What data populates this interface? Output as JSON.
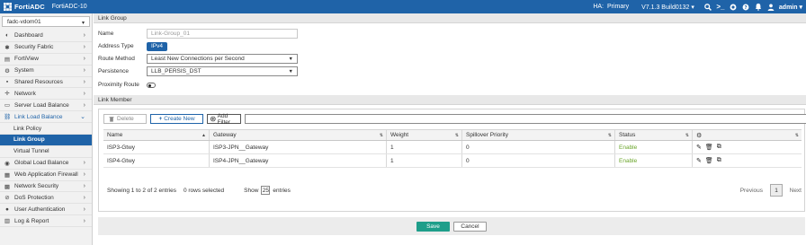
{
  "topbar": {
    "brand": "FortiADC",
    "model": "FortiADC-10",
    "ha_label": "HA:",
    "ha_value": "Primary",
    "version": "V7.1.3 Build0132",
    "version_caret": "▾",
    "user": "admin",
    "user_caret": "▾",
    "colors": {
      "bar": "#1f63a8"
    }
  },
  "sidebar": {
    "vdom": "fadc-vdom01",
    "items": [
      {
        "label": "Dashboard",
        "icon": "dashboard-icon",
        "glyph": "◐"
      },
      {
        "label": "Security Fabric",
        "icon": "security-fabric-icon",
        "glyph": "✱"
      },
      {
        "label": "FortiView",
        "icon": "fortiview-icon",
        "glyph": "▤"
      },
      {
        "label": "System",
        "icon": "gear-icon",
        "glyph": "⚙"
      },
      {
        "label": "Shared Resources",
        "icon": "shared-resources-icon",
        "glyph": "▪"
      },
      {
        "label": "Network",
        "icon": "network-icon",
        "glyph": "✛"
      },
      {
        "label": "Server Load Balance",
        "icon": "server-load-balance-icon",
        "glyph": "▭"
      },
      {
        "label": "Link Load Balance",
        "icon": "link-icon",
        "glyph": "🔗"
      },
      {
        "label": "Link Policy"
      },
      {
        "label": "Link Group"
      },
      {
        "label": "Virtual Tunnel"
      },
      {
        "label": "Global Load Balance",
        "icon": "globe-icon",
        "glyph": "◉"
      },
      {
        "label": "Web Application Firewall",
        "icon": "waf-icon",
        "glyph": "▦"
      },
      {
        "label": "Network Security",
        "icon": "network-security-icon",
        "glyph": "▩"
      },
      {
        "label": "DoS Protection",
        "icon": "dos-icon",
        "glyph": "⊘"
      },
      {
        "label": "User Authentication",
        "icon": "user-icon",
        "glyph": "●"
      },
      {
        "label": "Log & Report",
        "icon": "log-icon",
        "glyph": "▥"
      }
    ]
  },
  "form": {
    "section_title": "Link Group",
    "name_label": "Name",
    "name_placeholder": "Link-Group_01",
    "address_type_label": "Address Type",
    "address_type_value": "IPv4",
    "route_method_label": "Route Method",
    "route_method_value": "Least New Connections per Second",
    "persistence_label": "Persistence",
    "persistence_value": "LLB_PERSIS_DST",
    "proximity_label": "Proximity Route"
  },
  "link_member": {
    "section_title": "Link Member",
    "delete_label": "Delete",
    "create_label": "Create New",
    "filter_label": "Add Filter",
    "columns": [
      "Name",
      "Gateway",
      "Weight",
      "Spillover Priority",
      "Status"
    ],
    "rows": [
      {
        "name": "ISP3-Gtwy",
        "gateway": "ISP3-JPN__Gateway",
        "weight": "1",
        "spillover": "0",
        "status": "Enable"
      },
      {
        "name": "ISP4-Gtwy",
        "gateway": "ISP4-JPN__Gateway",
        "weight": "1",
        "spillover": "0",
        "status": "Enable"
      }
    ],
    "pager": {
      "info": "Showing 1 to 2 of 2 entries",
      "selected": "0 rows selected",
      "show_label": "Show",
      "page_size": "25",
      "entries_label": "entries",
      "prev": "Previous",
      "page": "1",
      "next": "Next"
    }
  },
  "footer": {
    "save": "Save",
    "cancel": "Cancel"
  }
}
